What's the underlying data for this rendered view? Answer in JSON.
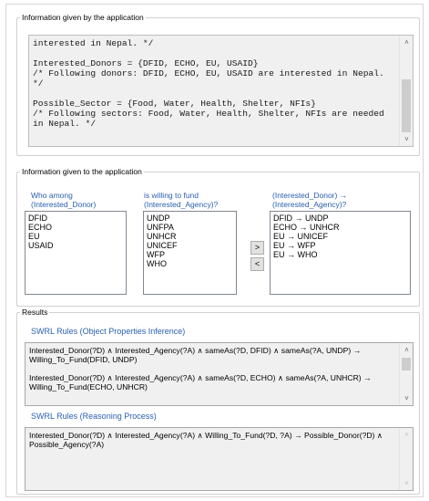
{
  "app_info": {
    "legend": "Information given by the application",
    "code_lines": [
      "interested in Nepal. */",
      "",
      "Interested_Donors = {DFID, ECHO, EU, USAID}",
      "/* Following donors: DFID, ECHO, EU, USAID are interested in Nepal.",
      "*/",
      "",
      "Possible_Sector = {Food, Water, Health, Shelter, NFIs}",
      "/* Following sectors: Food, Water, Health, Shelter, NFIs are needed",
      "in Nepal. */"
    ]
  },
  "given_info": {
    "legend": "Information given to the application",
    "col1_caption_1": "Who among",
    "col1_caption_2": "(Interested_Donor)",
    "col2_caption_1": "is willing to fund",
    "col2_caption_2": "(Interested_Agency)?",
    "col3_caption_1": "(Interested_Donor) →",
    "col3_caption_2": "(Interested_Agency)?",
    "donors": [
      "DFID",
      "ECHO",
      "EU",
      "USAID"
    ],
    "agencies": [
      "UNDP",
      "UNFPA",
      "UNHCR",
      "UNICEF",
      "WFP",
      "WHO"
    ],
    "pairs": [
      "DFID → UNDP",
      "ECHO → UNHCR",
      "EU → UNICEF",
      "EU → WFP",
      "EU → WHO"
    ],
    "add_button": ">",
    "remove_button": "<"
  },
  "results": {
    "legend": "Results",
    "object_heading": "SWRL Rules (Object Properties Inference)",
    "object_rules": [
      "Interested_Donor(?D) ∧ Interested_Agency(?A) ∧ sameAs(?D, DFID) ∧ sameAs(?A, UNDP) → Willing_To_Fund(DFID, UNDP)",
      "Interested_Donor(?D) ∧ Interested_Agency(?A) ∧ sameAs(?D, ECHO) ∧ sameAs(?A, UNHCR) → Willing_To_Fund(ECHO, UNHCR)"
    ],
    "reasoning_heading": "SWRL Rules (Reasoning Process)",
    "reasoning_rules": [
      "Interested_Donor(?D) ∧ Interested_Agency(?A) ∧ Willing_To_Fund(?D, ?A) → Possible_Donor(?D) ∧ Possible_Agency(?A)"
    ]
  },
  "icons": {
    "scroll_up": "chevron-up-icon",
    "scroll_down": "chevron-down-icon"
  }
}
